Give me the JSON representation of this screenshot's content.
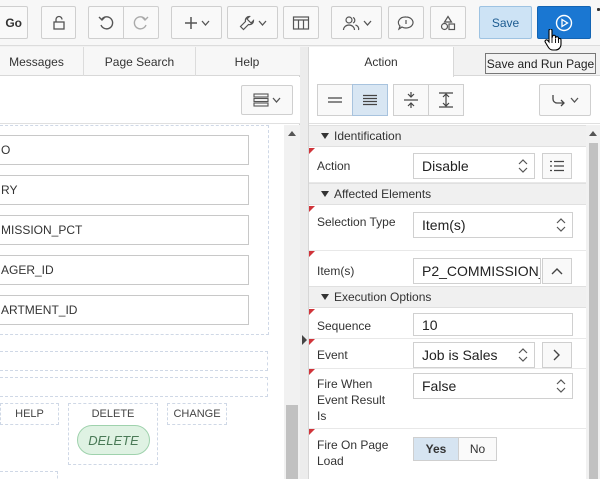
{
  "toolbar": {
    "go_label": "Go",
    "save_label": "Save",
    "run_tooltip": "Save and Run Page"
  },
  "left_panel": {
    "tabs": [
      {
        "label": "Messages"
      },
      {
        "label": "Page Search"
      },
      {
        "label": "Help"
      }
    ],
    "fields": [
      {
        "label": "O"
      },
      {
        "label": "RY"
      },
      {
        "label": "MISSION_PCT"
      },
      {
        "label": "AGER_ID"
      },
      {
        "label": "ARTMENT_ID"
      }
    ],
    "button_columns": [
      {
        "label": "HELP"
      },
      {
        "label": "DELETE"
      },
      {
        "label": "CHANGE"
      }
    ],
    "delete_button": "DELETE"
  },
  "right_panel": {
    "tab": "Action",
    "groups": {
      "identification": "Identification",
      "affected": "Affected Elements",
      "execution": "Execution Options"
    },
    "properties": {
      "action": {
        "label": "Action",
        "value": "Disable"
      },
      "selection_type": {
        "label": "Selection Type",
        "value": "Item(s)"
      },
      "items": {
        "label": "Item(s)",
        "value": "P2_COMMISSION_PCT"
      },
      "sequence": {
        "label": "Sequence",
        "value": "10"
      },
      "event": {
        "label": "Event",
        "value": "Job is Sales"
      },
      "fire_when": {
        "label": "Fire When Event Result Is",
        "value": "False"
      },
      "fire_on_load": {
        "label": "Fire On Page Load",
        "yes": "Yes",
        "no": "No",
        "selected": "Yes"
      }
    }
  },
  "colors": {
    "run_button": "#1a77d2",
    "save_button": "#cde3f5",
    "required_marker": "#d0343a",
    "delete_pill": "#dff2e3"
  }
}
